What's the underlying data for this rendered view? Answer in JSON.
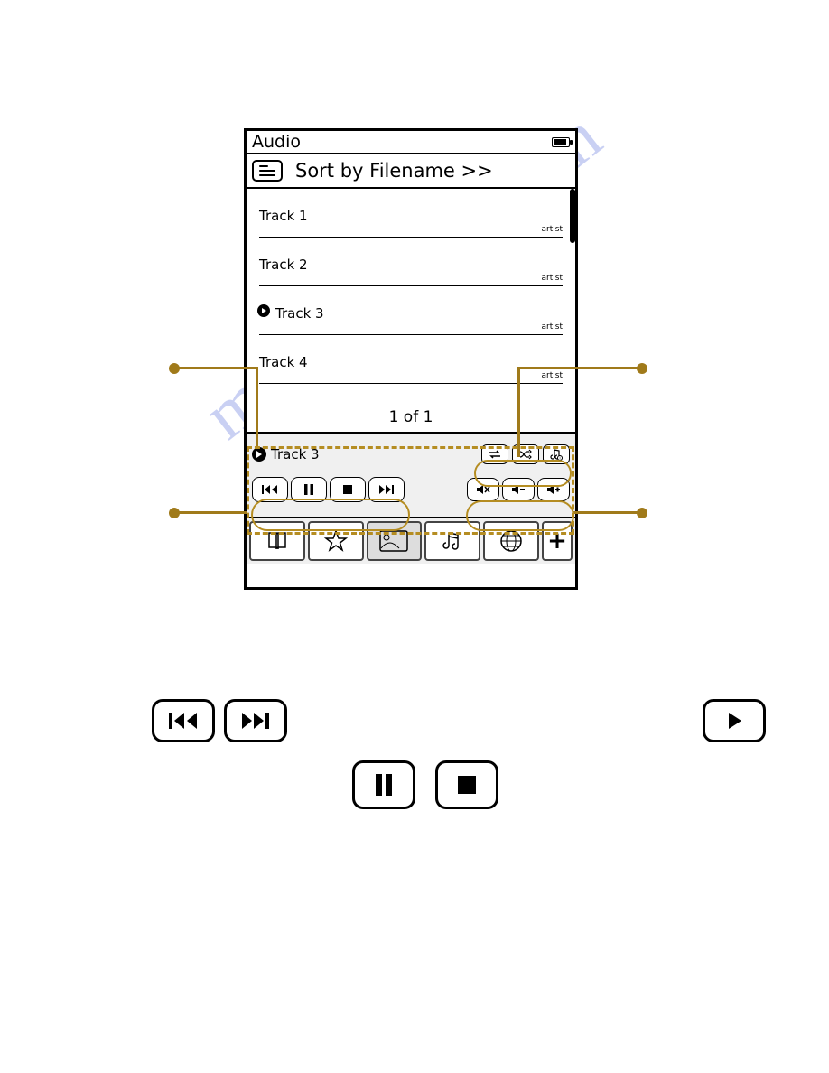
{
  "watermark": "manualslive.com",
  "screen": {
    "title": "Audio",
    "sort_label": "Sort by Filename >>",
    "tracks": [
      {
        "name": "Track 1",
        "artist": "artist",
        "playing": false
      },
      {
        "name": "Track 2",
        "artist": "artist",
        "playing": false
      },
      {
        "name": "Track 3",
        "artist": "artist",
        "playing": true
      },
      {
        "name": "Track 4",
        "artist": "artist",
        "playing": false
      }
    ],
    "pager": "1 of 1",
    "now_playing": "Track 3"
  },
  "callouts": {
    "top_left": "",
    "top_right": "",
    "bottom_left": "",
    "bottom_right": ""
  }
}
